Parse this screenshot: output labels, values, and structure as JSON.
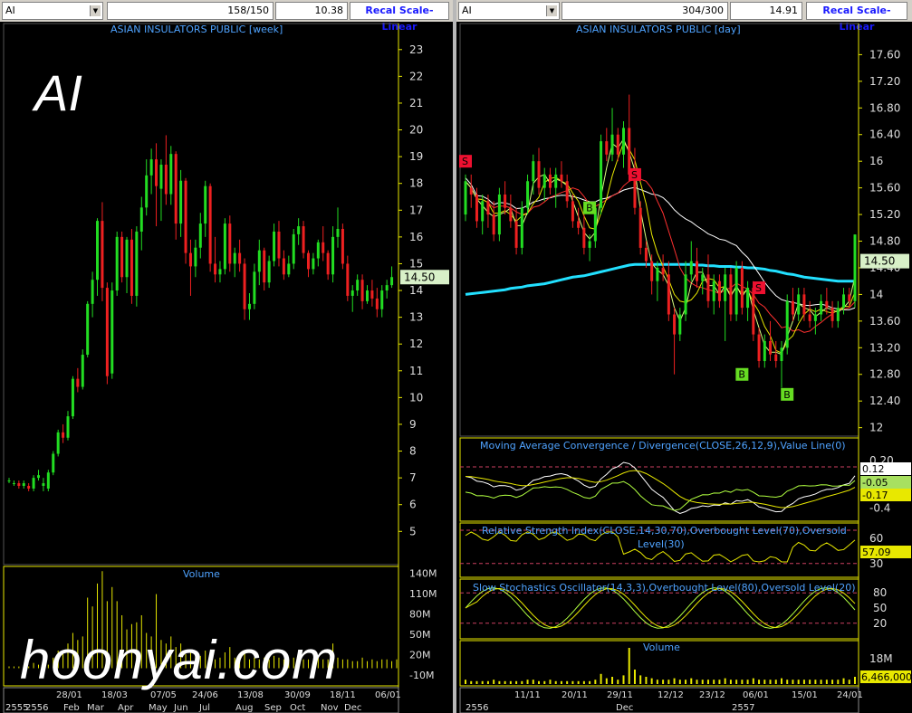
{
  "left": {
    "symbol": "AI",
    "bars_shown": "158/150",
    "last_value": "10.38",
    "scale_button": "Recal Scale-Linear",
    "title": "ASIAN INSULATORS PUBLIC [week]",
    "ticker_label": "AI",
    "price_tag": "14.50",
    "volume_title": "Volume",
    "volume_ticks": [
      "140M",
      "110M",
      "80M",
      "50M",
      "20M",
      "-10M"
    ],
    "date_labels": [
      "28/01",
      "18/03",
      "07/05",
      "24/06",
      "13/08",
      "30/09",
      "18/11",
      "06/01"
    ],
    "month_labels": [
      "2555",
      "2556",
      "Feb",
      "Mar",
      "Apr",
      "May",
      "Jun",
      "Jul",
      "Aug",
      "Sep",
      "Oct",
      "Nov",
      "Dec"
    ]
  },
  "right": {
    "symbol": "AI",
    "bars_shown": "304/300",
    "last_value": "14.91",
    "scale_button": "Recal Scale-Linear",
    "title": "ASIAN INSULATORS PUBLIC [day]",
    "price_tag": "14.50",
    "signals": [
      "S",
      "S",
      "S",
      "B",
      "B",
      "B"
    ],
    "macd_title": "Moving Average Convergence / Divergence(CLOSE,26,12,9),Value Line(0)",
    "macd_ticks": [
      "0.20",
      "-0.4"
    ],
    "macd_tags": [
      "0.12",
      "-0.05",
      "-0.17"
    ],
    "rsi_title_1": "Relative Strength Index(CLOSE,14,30,70),Overbought Level(70),Oversold",
    "rsi_title_2": "Level(30)",
    "rsi_ticks": [
      "60",
      "30"
    ],
    "rsi_tag": "57.09",
    "stoch_title": "Slow Stochastics Oscillator(14,3,3),Overbought Level(80),Oversold Level(20)",
    "stoch_ticks": [
      "80",
      "50",
      "20"
    ],
    "volume_title": "Volume",
    "volume_tick": "18M",
    "volume_tag": "6,466,000",
    "date_labels": [
      "11/11",
      "20/11",
      "29/11",
      "12/12",
      "23/12",
      "06/01",
      "15/01",
      "24/01"
    ],
    "month_labels": [
      "2556",
      "Dec",
      "2557"
    ]
  },
  "watermark": "hoonyai.com",
  "colors": {
    "up": "#22dd22",
    "down": "#ee2020",
    "axis": "#e8e800",
    "title": "#4fa3ff",
    "ma_cyan": "#22e0ff"
  },
  "chart_data": [
    {
      "type": "candlestick",
      "title": "ASIAN INSULATORS PUBLIC [week]",
      "ylim": [
        4.3,
        23.5
      ],
      "yticks": [
        5,
        6,
        7,
        8,
        9,
        10,
        11,
        12,
        13,
        14,
        15,
        16,
        17,
        18,
        19,
        20,
        21,
        22,
        23
      ],
      "ohlc": [
        [
          6.9,
          7.0,
          6.8,
          6.9
        ],
        [
          6.8,
          6.9,
          6.7,
          6.8
        ],
        [
          6.8,
          6.9,
          6.6,
          6.7
        ],
        [
          6.7,
          6.9,
          6.6,
          6.8
        ],
        [
          6.7,
          6.8,
          6.5,
          6.6
        ],
        [
          6.6,
          7.1,
          6.5,
          7.0
        ],
        [
          7.0,
          7.3,
          6.9,
          7.1
        ],
        [
          6.7,
          7.0,
          6.5,
          6.8
        ],
        [
          6.6,
          7.3,
          6.5,
          7.2
        ],
        [
          7.2,
          8.0,
          7.1,
          7.9
        ],
        [
          7.9,
          8.8,
          7.8,
          8.7
        ],
        [
          8.7,
          9.0,
          8.3,
          8.5
        ],
        [
          8.5,
          9.5,
          8.4,
          9.3
        ],
        [
          9.3,
          10.8,
          9.2,
          10.7
        ],
        [
          10.7,
          11.1,
          10.2,
          10.4
        ],
        [
          10.4,
          11.8,
          10.3,
          11.6
        ],
        [
          11.6,
          13.6,
          11.5,
          13.5
        ],
        [
          13.5,
          14.7,
          13.0,
          14.4
        ],
        [
          14.4,
          16.7,
          13.8,
          16.6
        ],
        [
          16.6,
          17.3,
          13.6,
          14.1
        ],
        [
          14.1,
          14.3,
          10.5,
          10.8
        ],
        [
          10.9,
          14.3,
          10.7,
          14.0
        ],
        [
          14.0,
          16.2,
          13.8,
          16.0
        ],
        [
          16.0,
          16.2,
          14.3,
          14.5
        ],
        [
          14.5,
          16.0,
          13.9,
          15.9
        ],
        [
          15.9,
          16.3,
          13.5,
          13.8
        ],
        [
          13.8,
          16.4,
          13.4,
          16.2
        ],
        [
          16.2,
          17.5,
          15.5,
          17.1
        ],
        [
          17.1,
          18.9,
          16.8,
          18.3
        ],
        [
          18.3,
          19.3,
          17.6,
          18.9
        ],
        [
          18.9,
          19.5,
          16.4,
          17.9
        ],
        [
          17.8,
          18.9,
          16.6,
          18.7
        ],
        [
          18.7,
          19.8,
          17.2,
          17.6
        ],
        [
          17.6,
          19.4,
          17.2,
          19.1
        ],
        [
          19.1,
          19.2,
          15.9,
          16.5
        ],
        [
          16.5,
          18.5,
          16.0,
          18.1
        ],
        [
          18.1,
          18.2,
          15.0,
          15.4
        ],
        [
          15.4,
          15.9,
          13.8,
          14.9
        ],
        [
          14.9,
          15.9,
          14.5,
          15.6
        ],
        [
          15.6,
          16.9,
          15.2,
          16.5
        ],
        [
          16.5,
          18.1,
          16.0,
          17.9
        ],
        [
          17.9,
          18.0,
          14.7,
          15.0
        ],
        [
          15.0,
          16.0,
          14.3,
          14.6
        ],
        [
          14.6,
          15.1,
          14.3,
          14.8
        ],
        [
          14.8,
          16.7,
          14.6,
          16.5
        ],
        [
          16.5,
          16.8,
          14.7,
          15.0
        ],
        [
          15.0,
          15.6,
          14.5,
          15.4
        ],
        [
          15.4,
          15.9,
          14.7,
          15.0
        ],
        [
          15.0,
          15.2,
          12.9,
          13.3
        ],
        [
          13.3,
          13.9,
          12.9,
          13.5
        ],
        [
          13.5,
          15.0,
          13.3,
          14.7
        ],
        [
          14.7,
          15.9,
          14.2,
          15.5
        ],
        [
          15.5,
          15.6,
          14.0,
          14.3
        ],
        [
          14.3,
          15.3,
          14.1,
          15.1
        ],
        [
          15.1,
          16.5,
          14.9,
          16.2
        ],
        [
          16.2,
          16.6,
          14.9,
          15.2
        ],
        [
          15.2,
          15.5,
          14.4,
          14.6
        ],
        [
          14.6,
          15.3,
          14.5,
          15.0
        ],
        [
          15.0,
          16.3,
          14.8,
          16.1
        ],
        [
          16.1,
          16.7,
          15.7,
          16.4
        ],
        [
          16.4,
          16.6,
          15.2,
          15.4
        ],
        [
          15.4,
          15.5,
          14.5,
          14.8
        ],
        [
          14.8,
          15.4,
          14.6,
          15.2
        ],
        [
          15.2,
          15.9,
          14.9,
          15.8
        ],
        [
          15.8,
          16.4,
          15.1,
          15.4
        ],
        [
          15.4,
          15.5,
          14.4,
          14.6
        ],
        [
          14.6,
          16.4,
          14.3,
          16.0
        ],
        [
          16.0,
          17.1,
          15.6,
          16.3
        ],
        [
          16.3,
          16.5,
          14.8,
          15.0
        ],
        [
          15.0,
          15.3,
          13.6,
          13.8
        ],
        [
          13.8,
          14.2,
          13.2,
          14.0
        ],
        [
          14.0,
          14.6,
          13.8,
          14.4
        ],
        [
          14.4,
          14.6,
          13.3,
          13.6
        ],
        [
          13.6,
          14.2,
          13.5,
          14.0
        ],
        [
          14.0,
          14.4,
          13.4,
          13.7
        ],
        [
          13.7,
          14.1,
          13.0,
          13.3
        ],
        [
          13.3,
          14.2,
          13.0,
          14.0
        ],
        [
          14.0,
          14.4,
          13.7,
          14.2
        ],
        [
          14.2,
          14.9,
          14.1,
          14.5
        ]
      ],
      "volume": [
        1,
        1,
        1,
        1,
        1,
        3,
        2,
        1,
        2,
        6,
        10,
        8,
        14,
        20,
        16,
        18,
        40,
        35,
        48,
        55,
        38,
        46,
        38,
        30,
        22,
        25,
        26,
        30,
        20,
        18,
        42,
        16,
        14,
        18,
        12,
        14,
        8,
        9,
        6,
        7,
        10,
        6,
        5,
        6,
        9,
        12,
        6,
        5,
        9,
        5,
        6,
        5,
        6,
        5,
        7,
        6,
        5,
        5,
        6,
        4,
        5,
        5,
        4,
        7,
        5,
        5,
        14,
        6,
        5,
        5,
        4,
        4,
        6,
        4,
        5,
        4,
        5,
        5,
        4,
        5
      ]
    },
    {
      "type": "candlestick",
      "title": "ASIAN INSULATORS PUBLIC [day]",
      "ylim": [
        11.9,
        17.85
      ],
      "yticks": [
        12,
        12.4,
        12.8,
        13.2,
        13.6,
        14,
        14.4,
        14.8,
        15.2,
        15.6,
        16,
        16.4,
        16.8,
        17.2,
        17.6
      ],
      "ohlc": [
        [
          15.2,
          15.8,
          15.1,
          15.7
        ],
        [
          15.6,
          15.8,
          15.3,
          15.5
        ],
        [
          15.5,
          15.6,
          15.0,
          15.1
        ],
        [
          15.1,
          15.5,
          14.9,
          15.4
        ],
        [
          15.4,
          15.5,
          15.0,
          15.2
        ],
        [
          15.2,
          15.4,
          14.8,
          14.9
        ],
        [
          14.9,
          15.6,
          14.8,
          15.5
        ],
        [
          15.5,
          15.7,
          15.2,
          15.3
        ],
        [
          15.3,
          15.5,
          15.0,
          15.1
        ],
        [
          15.1,
          15.3,
          14.6,
          14.7
        ],
        [
          14.7,
          15.4,
          14.6,
          15.3
        ],
        [
          15.3,
          15.8,
          15.2,
          15.7
        ],
        [
          15.7,
          16.1,
          15.5,
          16.0
        ],
        [
          16.0,
          16.2,
          15.5,
          15.6
        ],
        [
          15.6,
          15.9,
          15.4,
          15.8
        ],
        [
          15.8,
          15.9,
          15.5,
          15.6
        ],
        [
          15.6,
          15.9,
          15.3,
          15.8
        ],
        [
          15.8,
          16.0,
          15.6,
          15.7
        ],
        [
          15.7,
          15.8,
          15.3,
          15.4
        ],
        [
          15.4,
          15.5,
          15.0,
          15.1
        ],
        [
          15.1,
          15.3,
          14.9,
          15.0
        ],
        [
          15.0,
          15.2,
          14.6,
          14.7
        ],
        [
          14.7,
          14.9,
          14.5,
          14.8
        ],
        [
          14.8,
          15.4,
          14.7,
          15.3
        ],
        [
          15.3,
          16.4,
          15.2,
          16.3
        ],
        [
          16.3,
          16.5,
          16.0,
          16.1
        ],
        [
          16.1,
          16.8,
          16.0,
          16.4
        ],
        [
          16.4,
          16.5,
          16.0,
          16.1
        ],
        [
          16.1,
          16.6,
          15.9,
          16.5
        ],
        [
          16.5,
          17.0,
          15.7,
          15.8
        ],
        [
          15.8,
          16.2,
          15.2,
          15.3
        ],
        [
          15.3,
          15.4,
          14.6,
          14.7
        ],
        [
          14.7,
          14.8,
          14.4,
          14.5
        ],
        [
          14.5,
          14.6,
          14.0,
          14.2
        ],
        [
          14.2,
          14.5,
          13.9,
          14.4
        ],
        [
          14.4,
          14.6,
          14.2,
          14.3
        ],
        [
          14.3,
          14.5,
          13.6,
          13.7
        ],
        [
          13.7,
          13.8,
          12.8,
          13.4
        ],
        [
          13.4,
          13.8,
          13.3,
          13.7
        ],
        [
          13.7,
          14.5,
          13.6,
          14.3
        ],
        [
          14.3,
          14.8,
          14.2,
          14.5
        ],
        [
          14.5,
          14.7,
          14.1,
          14.2
        ],
        [
          14.2,
          14.4,
          14.0,
          14.3
        ],
        [
          14.3,
          14.6,
          13.8,
          13.9
        ],
        [
          13.9,
          14.3,
          13.7,
          14.2
        ],
        [
          14.2,
          14.3,
          13.8,
          13.9
        ],
        [
          13.9,
          14.4,
          13.3,
          14.3
        ],
        [
          14.3,
          14.4,
          13.6,
          13.7
        ],
        [
          13.7,
          14.5,
          13.6,
          14.4
        ],
        [
          14.4,
          14.5,
          13.7,
          13.8
        ],
        [
          13.8,
          14.2,
          13.6,
          14.1
        ],
        [
          14.1,
          14.2,
          13.3,
          13.4
        ],
        [
          13.4,
          13.5,
          12.9,
          13.0
        ],
        [
          13.0,
          13.4,
          12.9,
          13.3
        ],
        [
          13.3,
          13.6,
          13.0,
          13.1
        ],
        [
          13.1,
          13.3,
          12.9,
          13.0
        ],
        [
          13.0,
          13.3,
          12.6,
          13.2
        ],
        [
          13.2,
          14.0,
          13.1,
          13.9
        ],
        [
          13.9,
          14.1,
          13.6,
          13.7
        ],
        [
          13.7,
          14.1,
          13.6,
          14.0
        ],
        [
          14.0,
          14.1,
          13.6,
          13.7
        ],
        [
          13.7,
          13.9,
          13.5,
          13.6
        ],
        [
          13.6,
          13.8,
          13.4,
          13.7
        ],
        [
          13.7,
          14.0,
          13.6,
          13.9
        ],
        [
          13.9,
          14.1,
          13.7,
          13.8
        ],
        [
          13.8,
          13.9,
          13.5,
          13.6
        ],
        [
          13.6,
          13.9,
          13.5,
          13.8
        ],
        [
          13.8,
          14.1,
          13.7,
          14.0
        ],
        [
          14.0,
          14.1,
          13.8,
          13.9
        ],
        [
          13.9,
          14.9,
          13.8,
          14.9
        ]
      ],
      "ma_slow": [
        14.0,
        14.01,
        14.02,
        14.03,
        14.04,
        14.05,
        14.06,
        14.07,
        14.09,
        14.1,
        14.11,
        14.13,
        14.14,
        14.15,
        14.16,
        14.18,
        14.2,
        14.22,
        14.24,
        14.26,
        14.27,
        14.28,
        14.3,
        14.32,
        14.34,
        14.36,
        14.38,
        14.4,
        14.42,
        14.44,
        14.45,
        14.45,
        14.45,
        14.45,
        14.45,
        14.45,
        14.45,
        14.45,
        14.45,
        14.45,
        14.45,
        14.44,
        14.44,
        14.43,
        14.43,
        14.42,
        14.42,
        14.42,
        14.41,
        14.41,
        14.4,
        14.4,
        14.39,
        14.38,
        14.36,
        14.35,
        14.33,
        14.31,
        14.3,
        14.28,
        14.26,
        14.25,
        14.24,
        14.23,
        14.22,
        14.21,
        14.2,
        14.2,
        14.2,
        14.2
      ],
      "signals": [
        {
          "label": "S",
          "bar": 0,
          "y": 16.0
        },
        {
          "label": "B",
          "bar": 22,
          "y": 15.3
        },
        {
          "label": "S",
          "bar": 30,
          "y": 15.8
        },
        {
          "label": "S",
          "bar": 52,
          "y": 14.1
        },
        {
          "label": "B",
          "bar": 49,
          "y": 12.8
        },
        {
          "label": "B",
          "bar": 57,
          "y": 12.5
        }
      ],
      "volume": [
        3,
        2,
        2,
        2,
        2,
        3,
        2,
        2,
        2,
        2,
        2,
        3,
        3,
        2,
        2,
        3,
        2,
        2,
        2,
        2,
        2,
        2,
        2,
        3,
        7,
        4,
        5,
        3,
        6,
        25,
        10,
        6,
        5,
        4,
        3,
        3,
        3,
        4,
        3,
        3,
        4,
        3,
        3,
        3,
        3,
        3,
        4,
        3,
        3,
        3,
        3,
        4,
        3,
        3,
        3,
        3,
        4,
        3,
        3,
        3,
        3,
        3,
        3,
        3,
        3,
        3,
        3,
        4,
        3,
        5
      ]
    }
  ]
}
